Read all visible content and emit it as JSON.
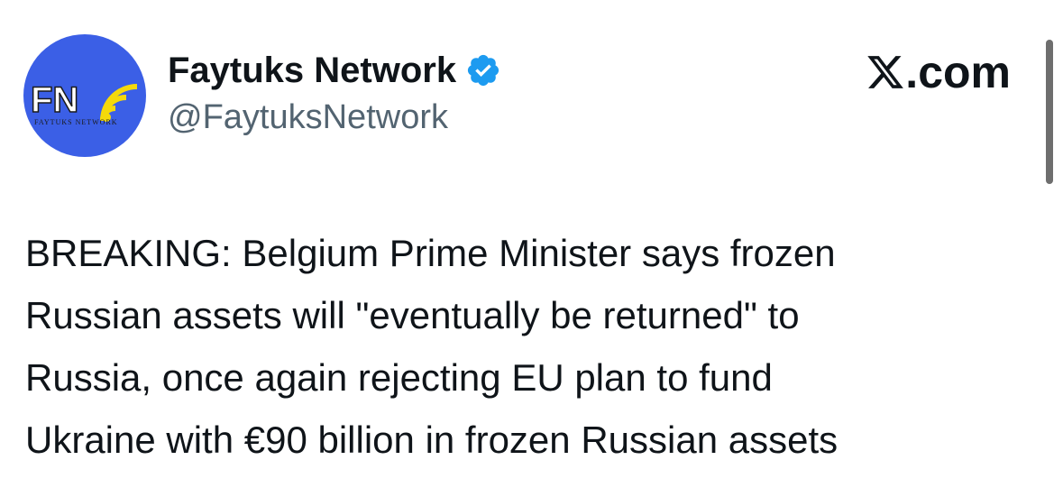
{
  "author": {
    "display_name": "Faytuks Network",
    "handle": "@FaytuksNetwork",
    "verified": true,
    "avatar": {
      "icon": "faytuks-network-logo",
      "logo_text": "FN",
      "tagline": "FAYTUKS NETWORK",
      "background_color": "#3b5fe6",
      "signal_color": "#f5d90a"
    }
  },
  "brand": {
    "icon": "x-logo-icon",
    "text": ".com"
  },
  "tweet": {
    "lines": [
      "BREAKING: Belgium Prime Minister says frozen",
      "Russian assets will \"eventually be returned\" to",
      "Russia, once again rejecting EU plan to fund",
      "Ukraine with €90 billion in frozen Russian assets"
    ]
  },
  "colors": {
    "text": "#0f1419",
    "secondary_text": "#536471",
    "verified_badge": "#1d9bf0",
    "scrollbar": "#6e6e6e"
  }
}
